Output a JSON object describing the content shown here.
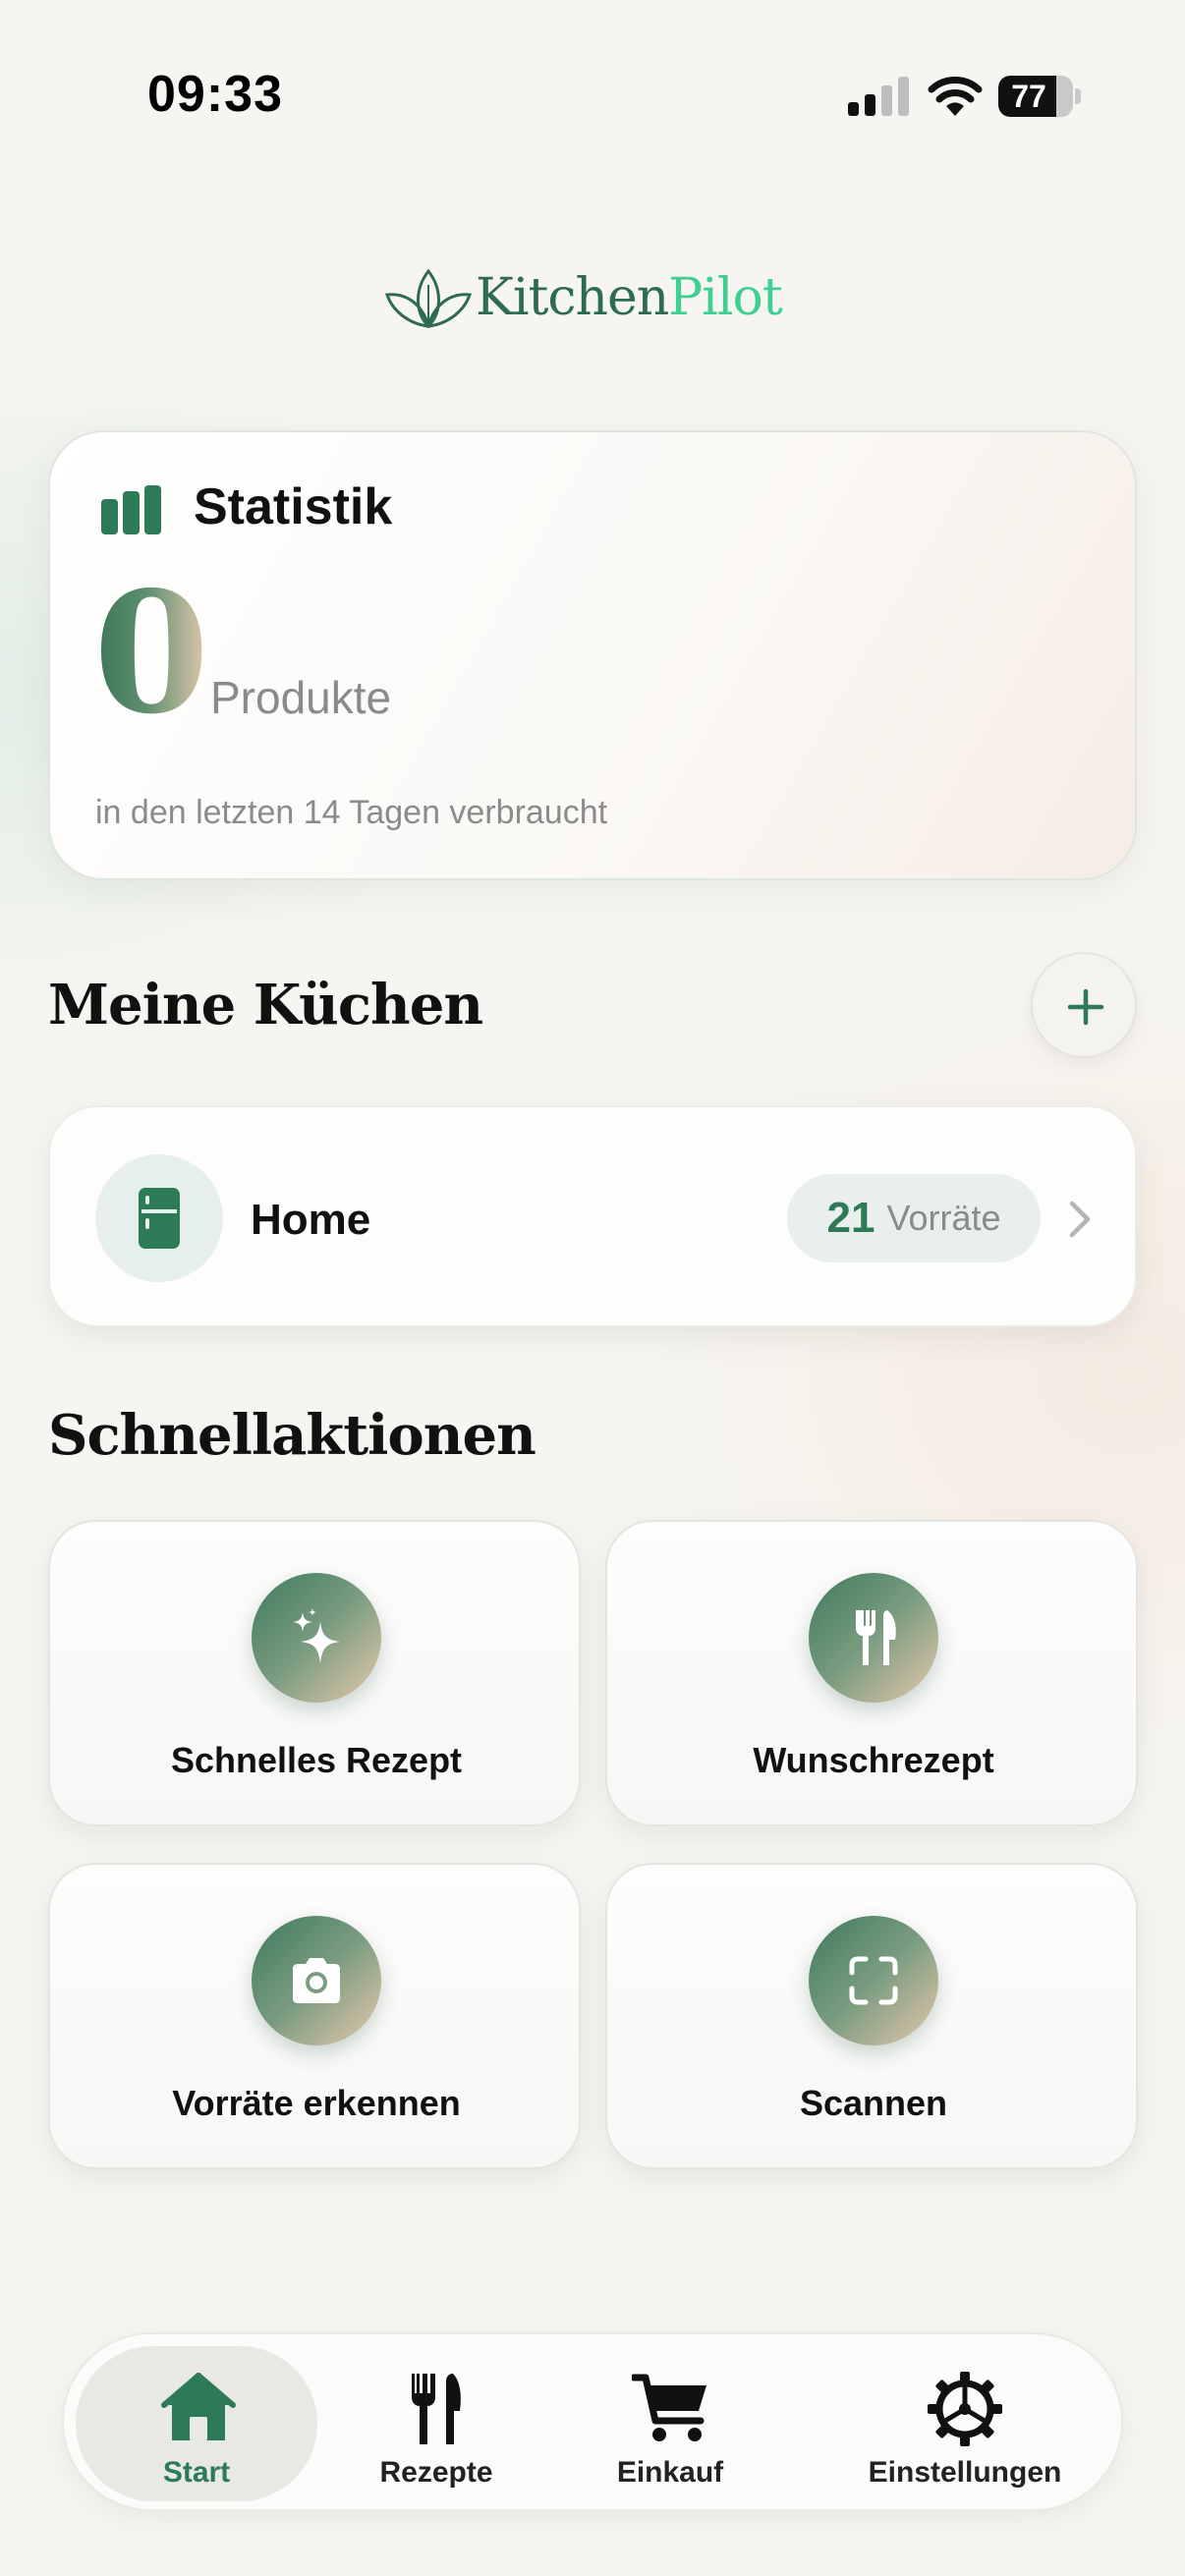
{
  "status_bar": {
    "time": "09:33",
    "battery_level": "77",
    "battery_fraction": 0.77,
    "icons": [
      "signal-icon",
      "wifi-icon",
      "battery-icon"
    ]
  },
  "logo": {
    "part1": "Kitchen",
    "part2": "Pilot",
    "icon": "leaf-logo-icon"
  },
  "stats": {
    "title": "Statistik",
    "icon": "bar-chart-icon",
    "value": "0",
    "unit": "Produkte",
    "caption": "in den letzten 14 Tagen verbraucht"
  },
  "kitchens": {
    "title": "Meine Küchen",
    "add_icon": "plus-icon",
    "items": [
      {
        "name": "Home",
        "icon": "fridge-icon",
        "stock_count": "21",
        "stock_label": "Vorräte"
      }
    ]
  },
  "quick_actions": {
    "title": "Schnellaktionen",
    "items": [
      {
        "label": "Schnelles Rezept",
        "icon": "sparkles-icon"
      },
      {
        "label": "Wunschrezept",
        "icon": "fork-knife-icon"
      },
      {
        "label": "Vorräte erkennen",
        "icon": "camera-icon"
      },
      {
        "label": "Scannen",
        "icon": "scan-frame-icon"
      }
    ]
  },
  "tab_bar": {
    "active": "Start",
    "tabs": [
      {
        "label": "Start",
        "icon": "home-icon"
      },
      {
        "label": "Rezepte",
        "icon": "fork-knife-icon"
      },
      {
        "label": "Einkauf",
        "icon": "cart-icon"
      },
      {
        "label": "Einstellungen",
        "icon": "gear-icon"
      }
    ]
  },
  "colors": {
    "accent": "#2d7a57",
    "logo_accent": "#3fcf93",
    "background": "#f6f5f1",
    "muted_text": "#8a8a8a"
  }
}
